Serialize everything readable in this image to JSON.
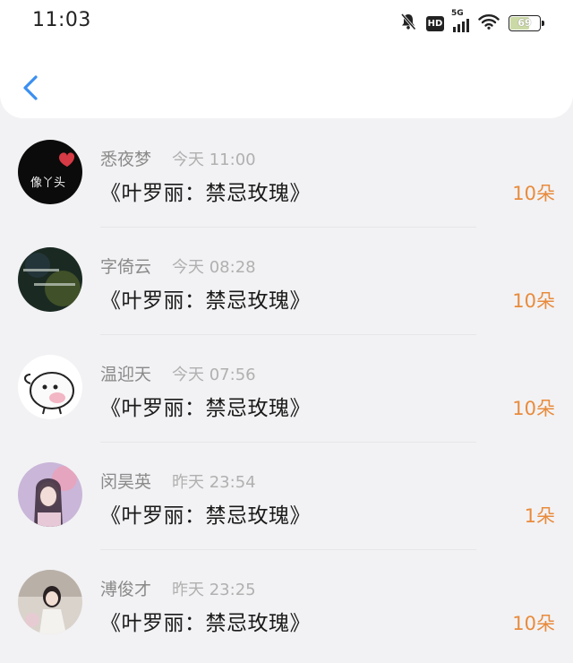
{
  "status_bar": {
    "time": "11:03",
    "network": "5G",
    "hd": "HD",
    "battery": "69"
  },
  "accent_color": "#e88b3c",
  "back_icon": "chevron-left-icon",
  "items": [
    {
      "name": "悉夜梦",
      "time": "今天 11:00",
      "message": "《叶罗丽：禁忌玫瑰》",
      "count": "10朵",
      "avatar_text": "像丫头"
    },
    {
      "name": "字倚云",
      "time": "今天 08:28",
      "message": "《叶罗丽：禁忌玫瑰》",
      "count": "10朵",
      "avatar_text": ""
    },
    {
      "name": "温迎天",
      "time": "今天 07:56",
      "message": "《叶罗丽：禁忌玫瑰》",
      "count": "10朵",
      "avatar_text": ""
    },
    {
      "name": "闵昊英",
      "time": "昨天 23:54",
      "message": "《叶罗丽：禁忌玫瑰》",
      "count": "1朵",
      "avatar_text": ""
    },
    {
      "name": "溥俊才",
      "time": "昨天 23:25",
      "message": "《叶罗丽：禁忌玫瑰》",
      "count": "10朵",
      "avatar_text": ""
    }
  ]
}
